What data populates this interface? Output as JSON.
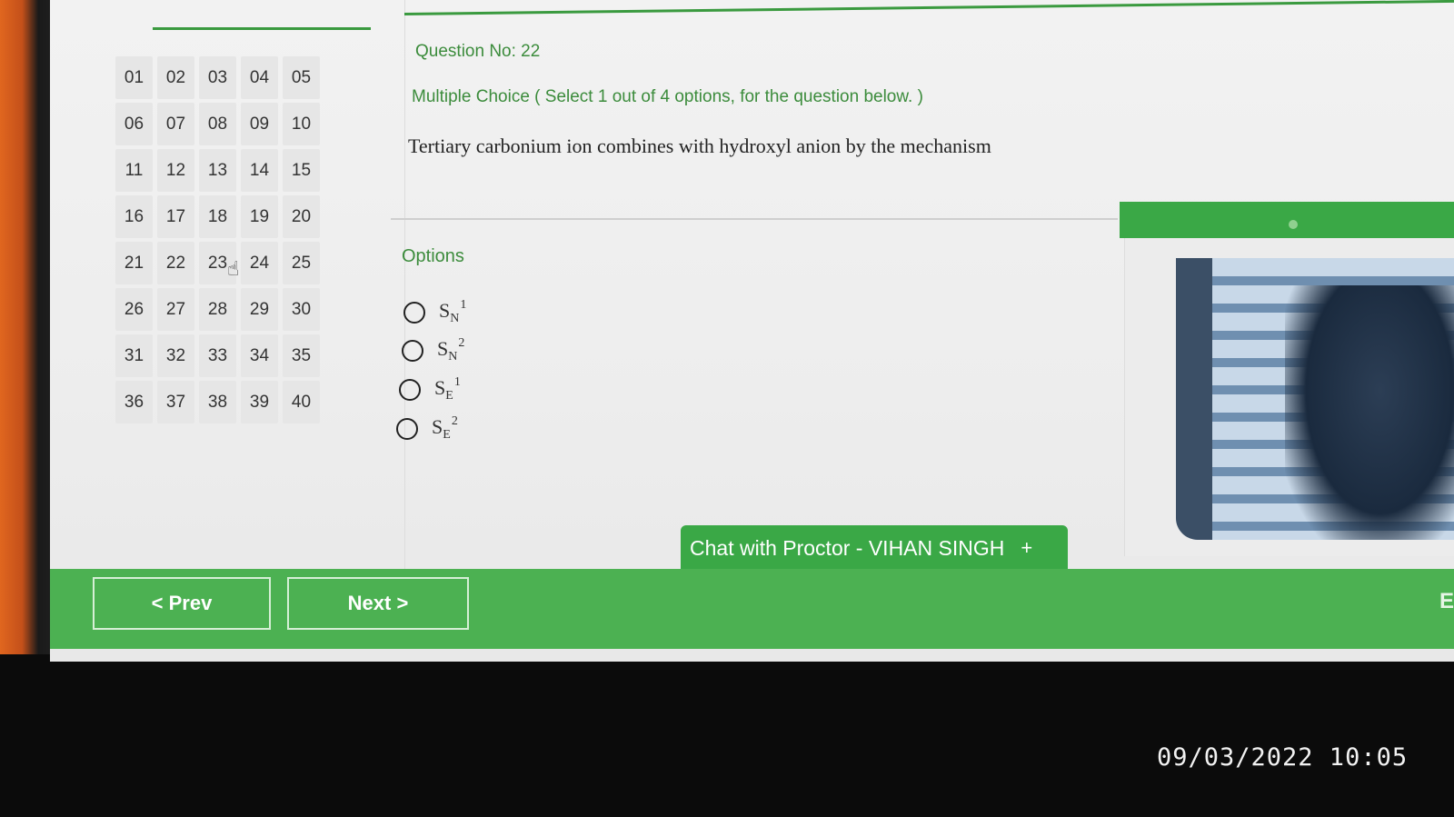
{
  "question_grid": {
    "numbers": [
      "01",
      "02",
      "03",
      "04",
      "05",
      "06",
      "07",
      "08",
      "09",
      "10",
      "11",
      "12",
      "13",
      "14",
      "15",
      "16",
      "17",
      "18",
      "19",
      "20",
      "21",
      "22",
      "23",
      "24",
      "25",
      "26",
      "27",
      "28",
      "29",
      "30",
      "31",
      "32",
      "33",
      "34",
      "35",
      "36",
      "37",
      "38",
      "39",
      "40"
    ]
  },
  "question": {
    "number_label": "Question No: 22",
    "type_label": "Multiple Choice ( Select 1 out of 4 options, for the question below. )",
    "text": "Tertiary carbonium ion combines with hydroxyl anion by the mechanism"
  },
  "options": {
    "title": "Options",
    "items": [
      {
        "base": "S",
        "sub": "N",
        "sup": "1"
      },
      {
        "base": "S",
        "sub": "N",
        "sup": "2"
      },
      {
        "base": "S",
        "sub": "E",
        "sup": "1"
      },
      {
        "base": "S",
        "sub": "E",
        "sup": "2"
      }
    ]
  },
  "chat": {
    "label": "Chat with Proctor - VIHAN SINGH",
    "plus": "+"
  },
  "nav": {
    "prev_label": "< Prev",
    "next_label": "Next >",
    "end_label": "E"
  },
  "photo": {
    "timestamp": "09/03/2022 10:05"
  },
  "colors": {
    "accent_green": "#4cb152",
    "label_green": "#3c8c3c"
  }
}
